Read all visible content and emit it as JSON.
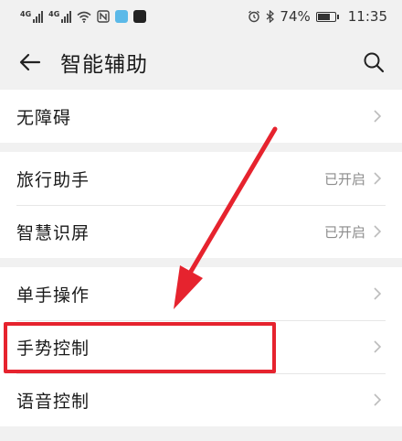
{
  "status_bar": {
    "signal1_label": "4G",
    "signal2_label": "4G",
    "battery": "74%",
    "time": "11:35"
  },
  "header": {
    "title": "智能辅助"
  },
  "groups": [
    {
      "items": [
        {
          "label": "无障碍",
          "value": ""
        }
      ]
    },
    {
      "items": [
        {
          "label": "旅行助手",
          "value": "已开启"
        },
        {
          "label": "智慧识屏",
          "value": "已开启"
        }
      ]
    },
    {
      "items": [
        {
          "label": "单手操作",
          "value": ""
        },
        {
          "label": "手势控制",
          "value": ""
        },
        {
          "label": "语音控制",
          "value": ""
        }
      ]
    }
  ],
  "icons": {
    "back": "back-arrow-icon",
    "search": "search-icon",
    "chevron": "chevron-right-icon"
  },
  "colors": {
    "annotation": "#e6232e",
    "background": "#f1f1f1",
    "value_text": "#8c8c8c"
  }
}
